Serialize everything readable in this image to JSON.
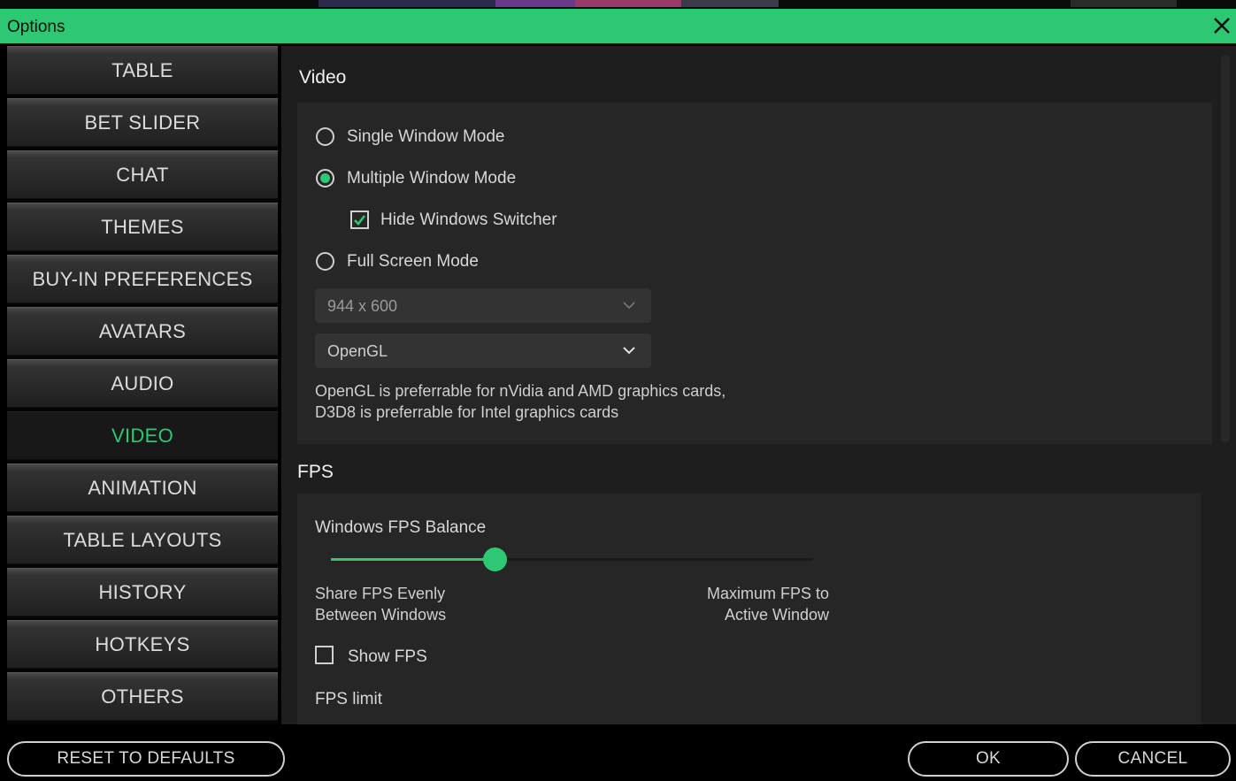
{
  "window": {
    "title": "Options"
  },
  "sidebar": {
    "items": [
      {
        "label": "TABLE"
      },
      {
        "label": "BET SLIDER"
      },
      {
        "label": "CHAT"
      },
      {
        "label": "THEMES"
      },
      {
        "label": "BUY-IN PREFERENCES"
      },
      {
        "label": "AVATARS"
      },
      {
        "label": "AUDIO"
      },
      {
        "label": "VIDEO",
        "active": true
      },
      {
        "label": "ANIMATION"
      },
      {
        "label": "TABLE LAYOUTS"
      },
      {
        "label": "HISTORY"
      },
      {
        "label": "HOTKEYS"
      },
      {
        "label": "OTHERS"
      }
    ]
  },
  "video": {
    "heading": "Video",
    "single_window_label": "Single Window Mode",
    "multiple_window_label": "Multiple Window Mode",
    "hide_switcher_label": "Hide Windows Switcher",
    "full_screen_label": "Full Screen Mode",
    "selected_mode": "Multiple Window Mode",
    "hide_switcher_checked": true,
    "resolution_value": "944 x 600",
    "renderer_value": "OpenGL",
    "renderer_note_line1": "OpenGL is preferrable for nVidia and AMD graphics cards,",
    "renderer_note_line2": "D3D8 is preferrable for Intel graphics cards"
  },
  "fps": {
    "heading": "FPS",
    "balance_label": "Windows FPS Balance",
    "balance_value_fraction": 0.34,
    "left_label_line1": "Share FPS Evenly",
    "left_label_line2": "Between Windows",
    "right_label_line1": "Maximum FPS to",
    "right_label_line2": "Active Window",
    "show_fps_label": "Show FPS",
    "show_fps_checked": false,
    "limit_label": "FPS limit"
  },
  "footer": {
    "reset_label": "RESET TO DEFAULTS",
    "ok_label": "OK",
    "cancel_label": "CANCEL"
  },
  "colors": {
    "accent": "#2ec872",
    "background": "#000000",
    "panel": "#262626"
  }
}
